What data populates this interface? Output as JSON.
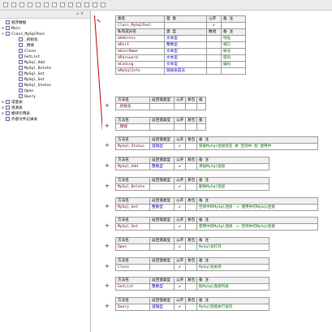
{
  "toolbar": {
    "icons": [
      "cut-icon",
      "copy-icon",
      "paste-icon",
      "undo-icon",
      "redo-icon",
      "find-icon",
      "indent-icon",
      "outdent-icon",
      "bookmark-icon",
      "run-icon",
      "step-icon",
      "pause-icon",
      "stop-icon"
    ]
  },
  "tree": {
    "header_controls": "▫ ×",
    "nodes": [
      {
        "label": "程序数据",
        "depth": 0,
        "exp": ""
      },
      {
        "label": "Main",
        "depth": 0,
        "exp": "⊞"
      },
      {
        "label": "Class_MySqlPool",
        "depth": 0,
        "exp": "⊟"
      },
      {
        "label": "_初始化",
        "depth": 2,
        "exp": ""
      },
      {
        "label": "_销毁",
        "depth": 2,
        "exp": ""
      },
      {
        "label": "Close",
        "depth": 2,
        "exp": ""
      },
      {
        "label": "GetList",
        "depth": 2,
        "exp": ""
      },
      {
        "label": "MySql_Add",
        "depth": 2,
        "exp": ""
      },
      {
        "label": "MySql_Delete",
        "depth": 2,
        "exp": ""
      },
      {
        "label": "MySql_Get",
        "depth": 2,
        "exp": ""
      },
      {
        "label": "MySql_Set",
        "depth": 2,
        "exp": ""
      },
      {
        "label": "MySql_Status",
        "depth": 2,
        "exp": ""
      },
      {
        "label": "Open",
        "depth": 2,
        "exp": ""
      },
      {
        "label": "Query",
        "depth": 2,
        "exp": ""
      },
      {
        "label": "常量表",
        "depth": 0,
        "exp": "⊞"
      },
      {
        "label": "资源表",
        "depth": 0,
        "exp": "⊞"
      },
      {
        "label": "模块引用表",
        "depth": 0,
        "exp": "⊞"
      },
      {
        "label": "外部文件记录表",
        "depth": 0,
        "exp": ""
      }
    ]
  },
  "class_table": {
    "headers": [
      "类名",
      "基 类",
      "公开",
      "备 注"
    ],
    "row": [
      "Class_MySqlPool",
      "",
      "✔",
      ""
    ],
    "var_headers": [
      "私有成员名",
      "类 型",
      "数组",
      "备 注"
    ],
    "vars": [
      [
        "mAddress",
        "文本型",
        "",
        "地址"
      ],
      [
        "mPort",
        "整数型",
        "",
        "端口"
      ],
      [
        "mUserName",
        "文本型",
        "",
        "帐号"
      ],
      [
        "mPassword",
        "文本型",
        "",
        "密码"
      ],
      [
        "mCoding",
        "文本型",
        "",
        "编码"
      ],
      [
        "mMySqlInfo",
        "链接表成员",
        "",
        ""
      ]
    ]
  },
  "method_headers": [
    "方法名",
    "返回值类型",
    "公开",
    "易包",
    "备 注"
  ],
  "methods": [
    {
      "name": "_初始化",
      "ret": "",
      "pub": "",
      "note": ""
    },
    {
      "name": "_销毁",
      "ret": "",
      "pub": "",
      "note": ""
    },
    {
      "name": "MySql_Status",
      "ret": "逻辑型",
      "pub": "✔",
      "note": "获取MySql连接状态 真 空闲中 假 使用中"
    },
    {
      "name": "MySql_Add",
      "ret": "整数型",
      "pub": "✔",
      "note": "添加MySql连接"
    },
    {
      "name": "MySql_Delete",
      "ret": "",
      "pub": "✔",
      "note": "删除MySql连接"
    },
    {
      "name": "MySql_Get",
      "ret": "整数型",
      "pub": "✔",
      "note": "空闲中的MySql连接 -> 使用中的MySql连接"
    },
    {
      "name": "MySql_Set",
      "ret": "",
      "pub": "✔",
      "note": "使用中的MySql连接 -> 空闲中的MySql连接"
    },
    {
      "name": "Open",
      "ret": "",
      "pub": "✔",
      "note": "MySql池打开"
    },
    {
      "name": "Close",
      "ret": "",
      "pub": "✔",
      "note": "MySql池关闭"
    },
    {
      "name": "GetList",
      "ret": "整数型",
      "pub": "✔",
      "note": "取MySql连接列表"
    },
    {
      "name": "Query",
      "ret": "逻辑型",
      "pub": "✔",
      "note": "MySql连接执行语句"
    }
  ],
  "plus_sign": "+"
}
